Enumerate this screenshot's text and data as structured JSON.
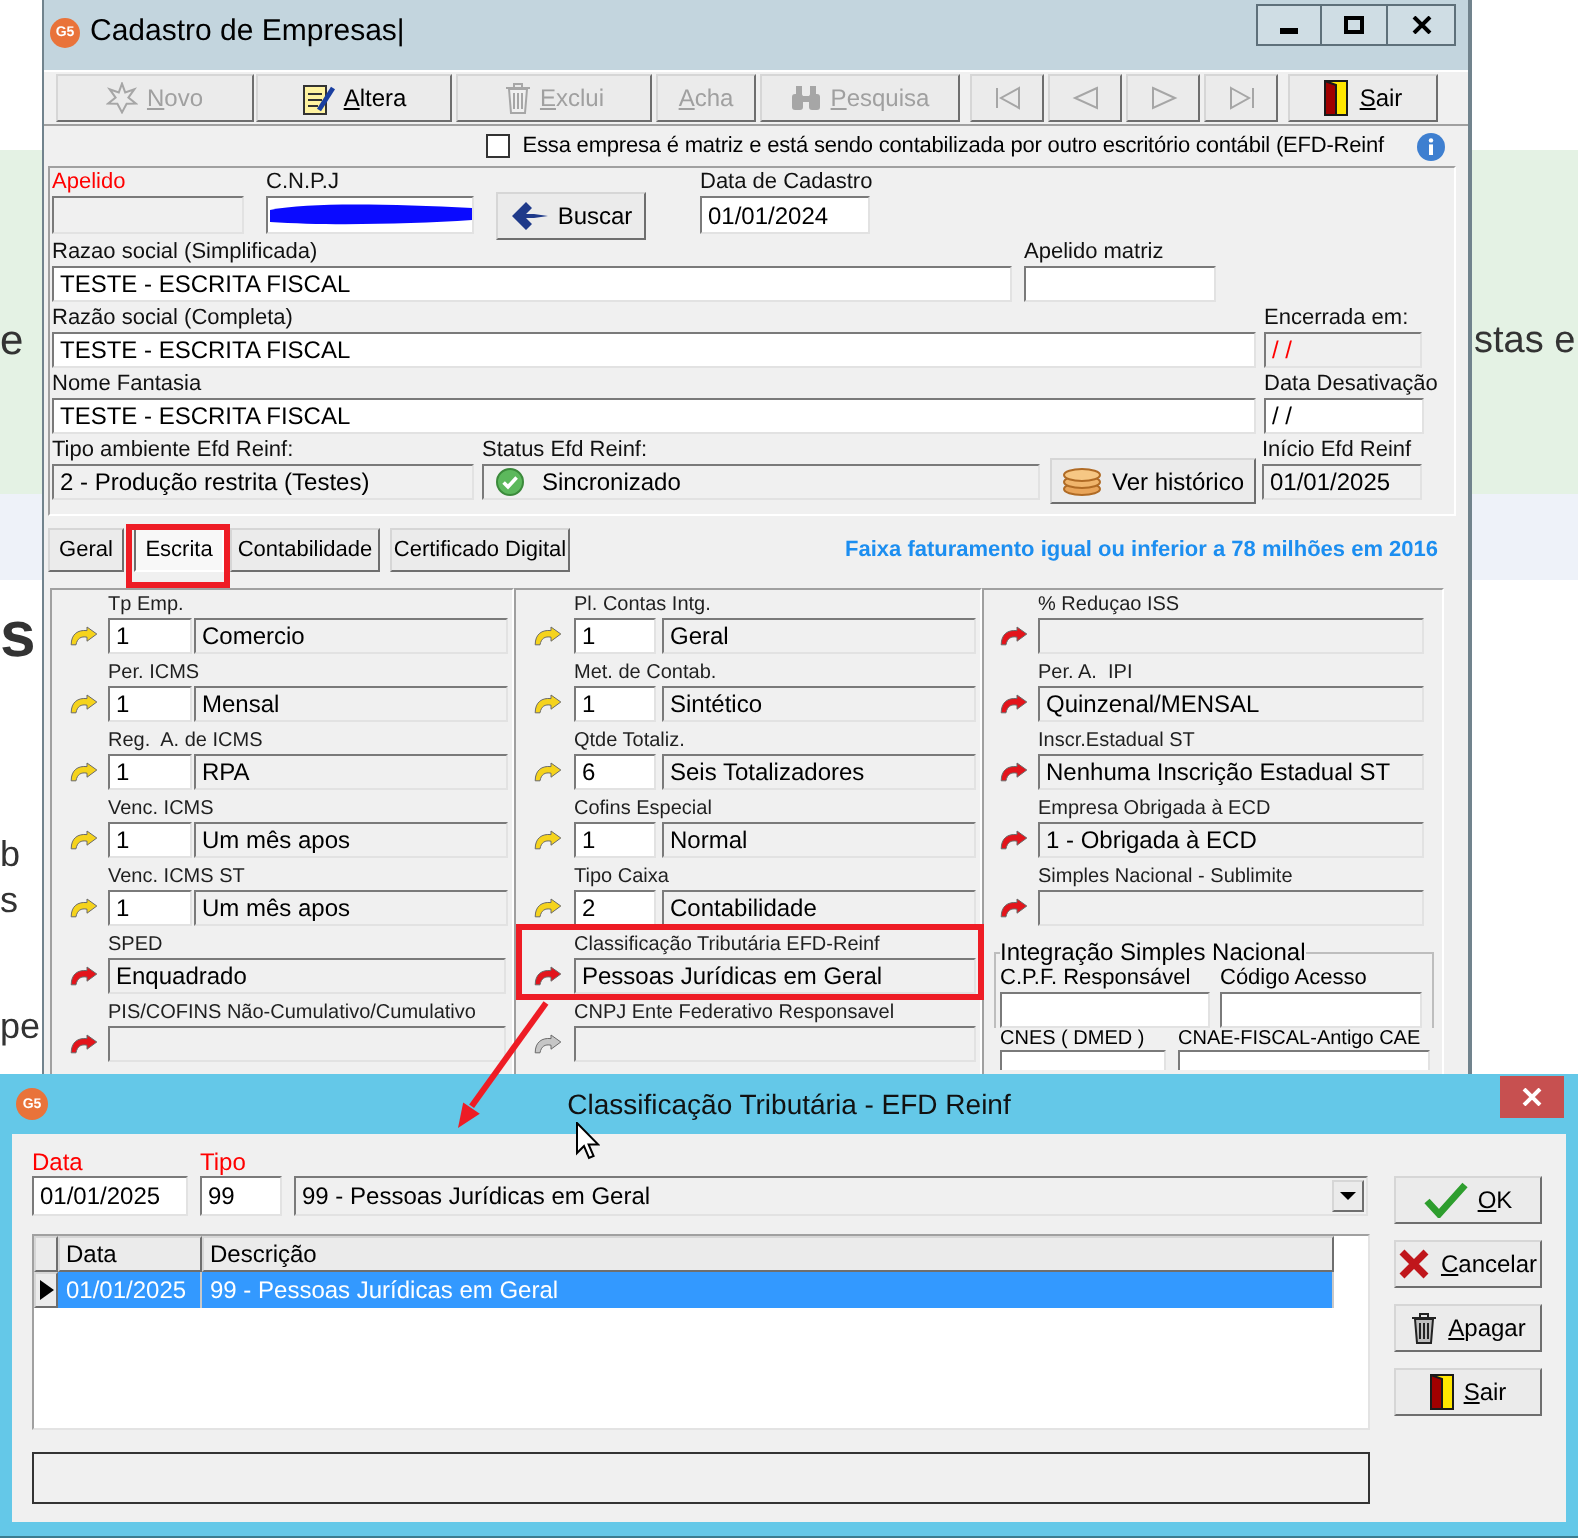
{
  "background_page": {
    "left_texts": [
      "e",
      "s",
      "b",
      "s",
      "pe"
    ],
    "right_texts": [
      "stas e"
    ]
  },
  "main_window": {
    "logo": "G5",
    "title": "Cadastro de Empresas|",
    "toolbar": {
      "actions": [
        {
          "label": "Novo",
          "disabled": true
        },
        {
          "label": "Altera",
          "disabled": false
        },
        {
          "label": "Exclui",
          "disabled": true
        },
        {
          "label": "Acha",
          "disabled": true
        },
        {
          "label": "Pesquisa",
          "disabled": true
        }
      ],
      "navigation": [
        {
          "disabled": true
        },
        {
          "disabled": true
        },
        {
          "disabled": true
        },
        {
          "disabled": true
        }
      ],
      "exit": {
        "label": "Sair",
        "disabled": false
      }
    },
    "matrix_checkbox": {
      "label": "Essa empresa é matriz e está sendo contabilizada por outro escritório contábil (EFD-Reinf",
      "checked": false
    },
    "company_form": {
      "apelido": {
        "label": "Apelido",
        "required": true,
        "readonly": true
      },
      "cnpj": {
        "label": "C.N.P.J",
        "required": false,
        "readonly": false,
        "redacted": true
      },
      "search_button": {
        "label": "Buscar"
      },
      "data_cadastro": {
        "label": "Data de Cadastro",
        "required": false,
        "readonly": false,
        "value": "01/01/2024"
      },
      "razao_simplificada": {
        "label": "Razao social (Simplificada)",
        "required": false,
        "readonly": false,
        "value": "TESTE - ESCRITA FISCAL"
      },
      "apelido_matriz": {
        "label": "Apelido matriz",
        "required": false,
        "readonly": false
      },
      "razao_completa": {
        "label": "Razão social (Completa)",
        "required": false,
        "readonly": false,
        "value": "TESTE - ESCRITA FISCAL"
      },
      "encerrada_em": {
        "label": "Encerrada em:",
        "required": false,
        "readonly": true,
        "value": "/ /",
        "alert": true
      },
      "nome_fantasia": {
        "label": "Nome Fantasia",
        "required": false,
        "readonly": false,
        "value": "TESTE - ESCRITA FISCAL"
      },
      "data_desativacao": {
        "label": "Data Desativação",
        "required": false,
        "readonly": false,
        "value": "/ /",
        "alert": false
      },
      "tipo_ambiente": {
        "label": "Tipo ambiente Efd Reinf:",
        "required": false,
        "readonly": true,
        "value": "2 - Produção restrita (Testes)"
      },
      "status_reinf": {
        "label": "Status Efd Reinf:",
        "required": false,
        "readonly": true,
        "value": "Sincronizado",
        "synced": true
      },
      "history_button": {
        "label": "Ver histórico"
      },
      "inicio_reinf": {
        "label": "Início Efd Reinf",
        "required": false,
        "readonly": true,
        "value": "01/01/2025"
      }
    },
    "tabs": [
      {
        "label": "Geral",
        "selected": false
      },
      {
        "label": "Escrita",
        "selected": true
      },
      {
        "label": "Contabilidade",
        "selected": false
      },
      {
        "label": "Certificado Digital",
        "selected": false
      }
    ],
    "revenue_note": "Faixa faturamento igual ou inferior a 78 milhões em 2016",
    "escrita_panel": {
      "columns": [
        {
          "items": [
            {
              "kind": "coded",
              "label": "Tp Emp.",
              "value": "1",
              "description": "Comercio",
              "color": "#f5d31c"
            },
            {
              "kind": "coded",
              "label": "Per. ICMS",
              "value": "1",
              "description": "Mensal",
              "color": "#f5d31c"
            },
            {
              "kind": "coded",
              "label": "Reg.  A. de ICMS",
              "value": "1",
              "description": "RPA",
              "color": "#f5d31c"
            },
            {
              "kind": "coded",
              "label": "Venc. ICMS",
              "value": "1",
              "description": "Um mês apos",
              "color": "#f5d31c"
            },
            {
              "kind": "coded",
              "label": "Venc. ICMS ST",
              "value": "1",
              "description": "Um mês apos",
              "color": "#f5d31c"
            },
            {
              "kind": "text",
              "label": "SPED",
              "value": "Enquadrado",
              "color": "#e3141b"
            },
            {
              "kind": "text",
              "label": "PIS/COFINS Não-Cumulativo/Cumulativo",
              "color": "#e3141b"
            }
          ]
        },
        {
          "items": [
            {
              "kind": "coded",
              "label": "Pl. Contas Intg.",
              "value": "1",
              "description": "Geral",
              "color": "#f5d31c"
            },
            {
              "kind": "coded",
              "label": "Met. de Contab.",
              "value": "1",
              "description": "Sintético",
              "color": "#f5d31c"
            },
            {
              "kind": "coded",
              "label": "Qtde Totaliz.",
              "value": "6",
              "description": "Seis Totalizadores",
              "color": "#f5d31c"
            },
            {
              "kind": "coded",
              "label": "Cofins Especial",
              "value": "1",
              "description": "Normal",
              "color": "#f5d31c"
            },
            {
              "kind": "coded",
              "label": "Tipo Caixa",
              "value": "2",
              "description": "Contabilidade",
              "color": "#f5d31c"
            },
            {
              "kind": "text",
              "label": "Classificação Tributária EFD-Reinf",
              "value": "Pessoas Jurídicas em Geral",
              "color": "#e3141b"
            },
            {
              "kind": "text",
              "label": "CNPJ Ente Federativo Responsavel",
              "color": "#c6c6c6"
            }
          ]
        },
        {
          "items": [
            {
              "kind": "text",
              "label": "% Reduçao ISS",
              "color": "#e3141b"
            },
            {
              "kind": "text",
              "label": "Per. A.  IPI",
              "value": "Quinzenal/MENSAL",
              "color": "#e3141b"
            },
            {
              "kind": "text",
              "label": "Inscr.Estadual ST",
              "value": "Nenhuma Inscrição Estadual ST",
              "color": "#e3141b"
            },
            {
              "kind": "text",
              "label": "Empresa Obrigada à ECD",
              "value": "1 - Obrigada à ECD",
              "color": "#e3141b"
            },
            {
              "kind": "text",
              "label": "Simples Nacional - Sublimite",
              "color": "#e3141b"
            },
            {
              "kind": "group",
              "title": "Integração Simples Nacional",
              "fields": [
                {
                  "label": "C.P.F. Responsável"
                },
                {
                  "label": "Código Acesso"
                }
              ]
            },
            {
              "kind": "pair",
              "fields": [
                {
                  "label": "CNES ( DMED )"
                },
                {
                  "label": "CNAE-FISCAL-Antigo CAE"
                }
              ]
            }
          ]
        }
      ]
    }
  },
  "annotations": [
    {
      "kind": "frame"
    },
    {
      "kind": "frame"
    },
    {
      "kind": "arrow"
    }
  ],
  "dialog": {
    "logo": "G5",
    "title": "Classificação Tributária - EFD Reinf",
    "date_field": {
      "label": "Data",
      "required": true,
      "value": "01/01/2025"
    },
    "type_field": {
      "label": "Tipo",
      "required": true,
      "value": "99"
    },
    "type_select": {
      "value": "99 - Pessoas Jurídicas em Geral"
    },
    "grid": {
      "columns": [
        "Data",
        "Descrição"
      ],
      "rows": [
        {
          "cells": [
            "01/01/2025",
            "99 - Pessoas Jurídicas em Geral"
          ],
          "selected": true
        }
      ]
    },
    "buttons": [
      {
        "label": "OK"
      },
      {
        "label": "Cancelar"
      },
      {
        "label": "Apagar"
      },
      {
        "label": "Sair"
      }
    ]
  }
}
